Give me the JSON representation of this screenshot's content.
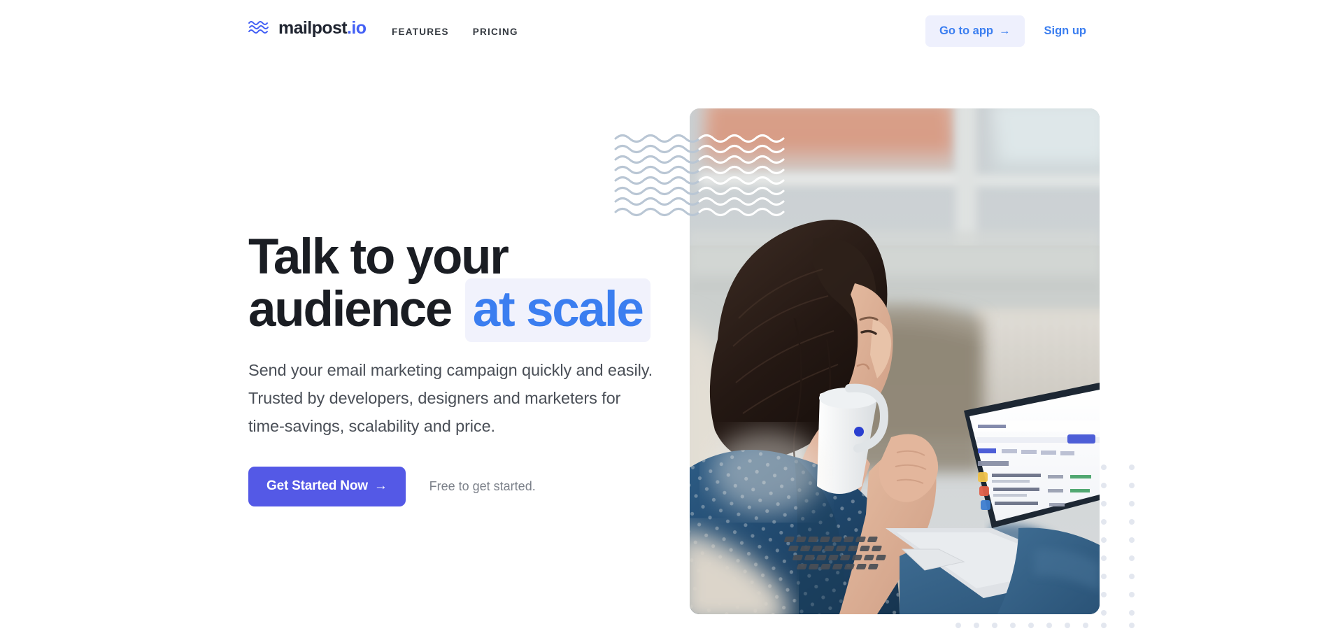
{
  "brand": {
    "name": "mailpost",
    "tld": ".io",
    "logo_icon": "waves-logo-icon"
  },
  "nav": {
    "links": [
      {
        "label": "FEATURES"
      },
      {
        "label": "PRICING"
      }
    ],
    "go_to_app": {
      "label": "Go to app",
      "arrow": "→"
    },
    "sign_up": {
      "label": "Sign up"
    }
  },
  "hero": {
    "headline_line1": "Talk to your",
    "headline_line2_plain": "audience ",
    "headline_highlight": "at scale",
    "subcopy": "Send your email marketing campaign quickly and easily. Trusted by developers, designers and marketers for time-savings, scalability and price.",
    "cta": {
      "label": "Get Started Now",
      "arrow": "→"
    },
    "cta_note": "Free to get started.",
    "image_alt": "Woman sitting on a couch drinking from a mug while working on a laptop showing an email dashboard"
  },
  "decor": {
    "waves_icon": "wave-lines-decoration-icon",
    "dots_icon": "dot-grid-decoration-icon"
  },
  "colors": {
    "brand_blue": "#4360f5",
    "link_blue": "#3b7ef0",
    "cta_indigo": "#5459e6",
    "goto_bg": "#eef0fd",
    "highlight_bg": "#f1f2fc",
    "headline": "#1a1d23",
    "body_text": "#4a4f57",
    "muted_text": "#7b8089",
    "dot_grey": "#e3e7ef",
    "wave_grey": "#b9c6d4"
  }
}
